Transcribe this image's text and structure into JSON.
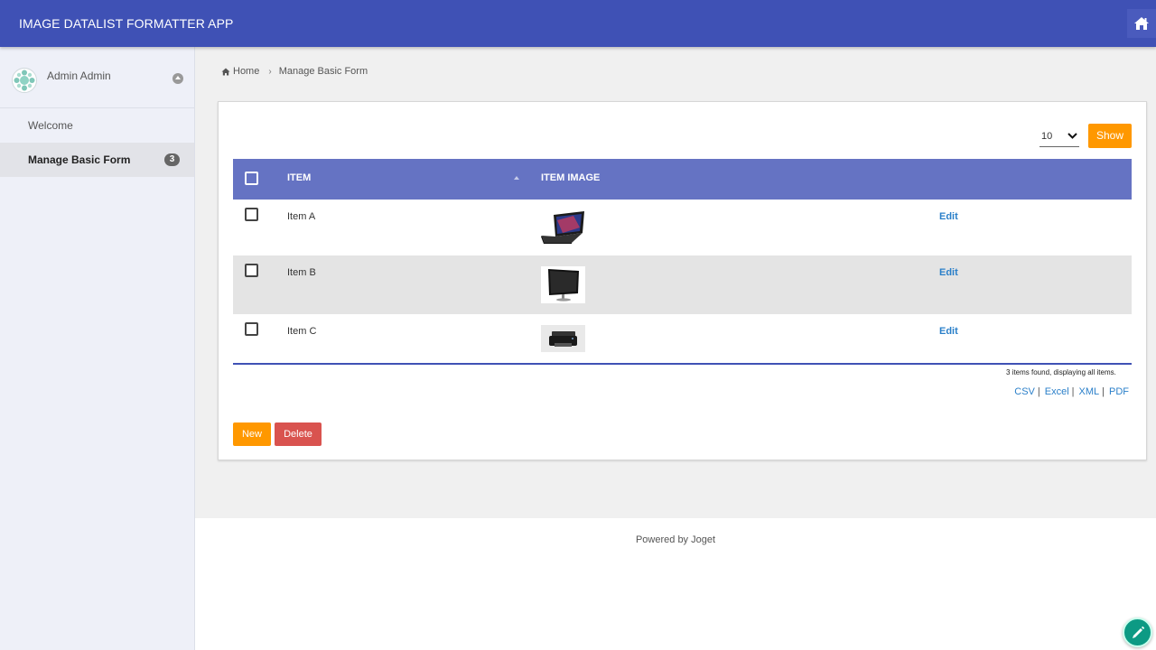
{
  "header": {
    "app_title": "IMAGE DATALIST FORMATTER APP",
    "home_icon": "home-icon"
  },
  "sidebar": {
    "user_name": "Admin Admin",
    "items": [
      {
        "label": "Welcome",
        "active": false
      },
      {
        "label": "Manage Basic Form",
        "active": true,
        "badge": "3"
      }
    ]
  },
  "breadcrumb": {
    "home": "Home",
    "current": "Manage Basic Form"
  },
  "list": {
    "page_size": "10",
    "show_label": "Show",
    "columns": [
      "ITEM",
      "ITEM IMAGE"
    ],
    "rows": [
      {
        "item": "Item A",
        "image": "laptop-image",
        "action": "Edit"
      },
      {
        "item": "Item B",
        "image": "monitor-image",
        "action": "Edit"
      },
      {
        "item": "Item C",
        "image": "printer-image",
        "action": "Edit"
      }
    ],
    "summary": "3 items found, displaying all items.",
    "exports": [
      "CSV",
      "Excel",
      "XML",
      "PDF"
    ],
    "new_label": "New",
    "delete_label": "Delete"
  },
  "footer": {
    "powered_by": "Powered by Joget"
  },
  "colors": {
    "header": "#3f51b5",
    "table_header": "#6573c3",
    "accent": "#ff9800",
    "danger": "#d9534f",
    "link": "#2a7fc9"
  }
}
